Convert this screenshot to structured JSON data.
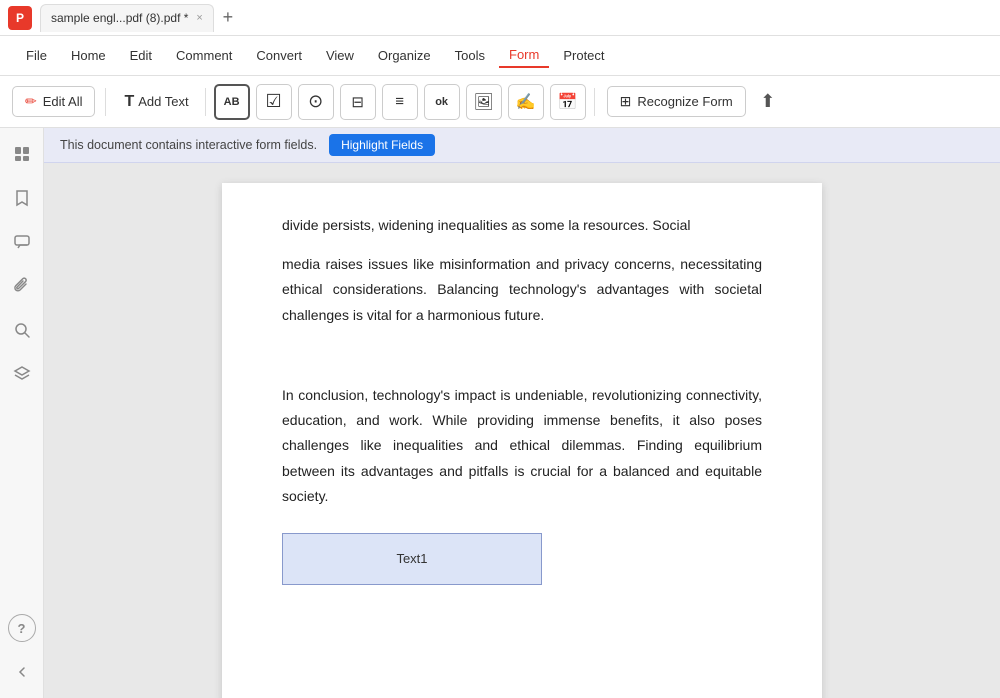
{
  "titleBar": {
    "appIcon": "P",
    "tab": {
      "label": "sample engl...pdf (8).pdf *",
      "closeLabel": "×"
    },
    "newTabLabel": "+"
  },
  "menuBar": {
    "items": [
      {
        "id": "file",
        "label": "File"
      },
      {
        "id": "home",
        "label": "Home"
      },
      {
        "id": "edit",
        "label": "Edit"
      },
      {
        "id": "comment",
        "label": "Comment"
      },
      {
        "id": "convert",
        "label": "Convert"
      },
      {
        "id": "view",
        "label": "View"
      },
      {
        "id": "organize",
        "label": "Organize"
      },
      {
        "id": "tools",
        "label": "Tools"
      },
      {
        "id": "form",
        "label": "Form",
        "active": true
      },
      {
        "id": "protect",
        "label": "Protect"
      }
    ]
  },
  "toolbar": {
    "editAllLabel": "Edit All",
    "editAllIcon": "✏️",
    "addTextLabel": "Add Text",
    "buttons": [
      {
        "id": "text-field",
        "icon": "AB",
        "type": "box-icon"
      },
      {
        "id": "checkbox",
        "icon": "✓",
        "type": "simple"
      },
      {
        "id": "radio",
        "icon": "◉",
        "type": "simple"
      },
      {
        "id": "dropdown",
        "icon": "⊟",
        "type": "simple"
      },
      {
        "id": "listbox",
        "icon": "≡",
        "type": "simple"
      },
      {
        "id": "ok-btn",
        "icon": "ok",
        "type": "box-icon"
      },
      {
        "id": "image-field",
        "icon": "🖼",
        "type": "simple"
      },
      {
        "id": "signature",
        "icon": "✍",
        "type": "simple"
      },
      {
        "id": "date",
        "icon": "📅",
        "type": "simple"
      }
    ],
    "recognizeFormLabel": "Recognize Form",
    "uploadIcon": "⬆"
  },
  "notification": {
    "message": "This document contains interactive form fields.",
    "buttonLabel": "Highlight Fields"
  },
  "sidebarIcons": [
    {
      "id": "pages",
      "icon": "⊞"
    },
    {
      "id": "bookmarks",
      "icon": "🔖"
    },
    {
      "id": "comments",
      "icon": "💬"
    },
    {
      "id": "attachments",
      "icon": "📎"
    },
    {
      "id": "search",
      "icon": "🔍"
    },
    {
      "id": "layers",
      "icon": "◈"
    }
  ],
  "sidebarBottom": [
    {
      "id": "help",
      "icon": "?"
    },
    {
      "id": "collapse",
      "icon": "‹"
    }
  ],
  "content": {
    "partialLine": "divide persists, widening inequalities as some la                   resources. Social",
    "paragraph1": "media raises issues like misinformation and privacy concerns, necessitating ethical considerations. Balancing technology's advantages with societal challenges is vital for a harmonious future.",
    "paragraph2": "In conclusion, technology's impact is undeniable, revolutionizing connectivity, education, and work. While providing immense benefits, it also poses challenges like inequalities and ethical dilemmas. Finding equilibrium between its advantages and pitfalls is crucial for a balanced and equitable society.",
    "formFieldLabel": "Text1"
  }
}
